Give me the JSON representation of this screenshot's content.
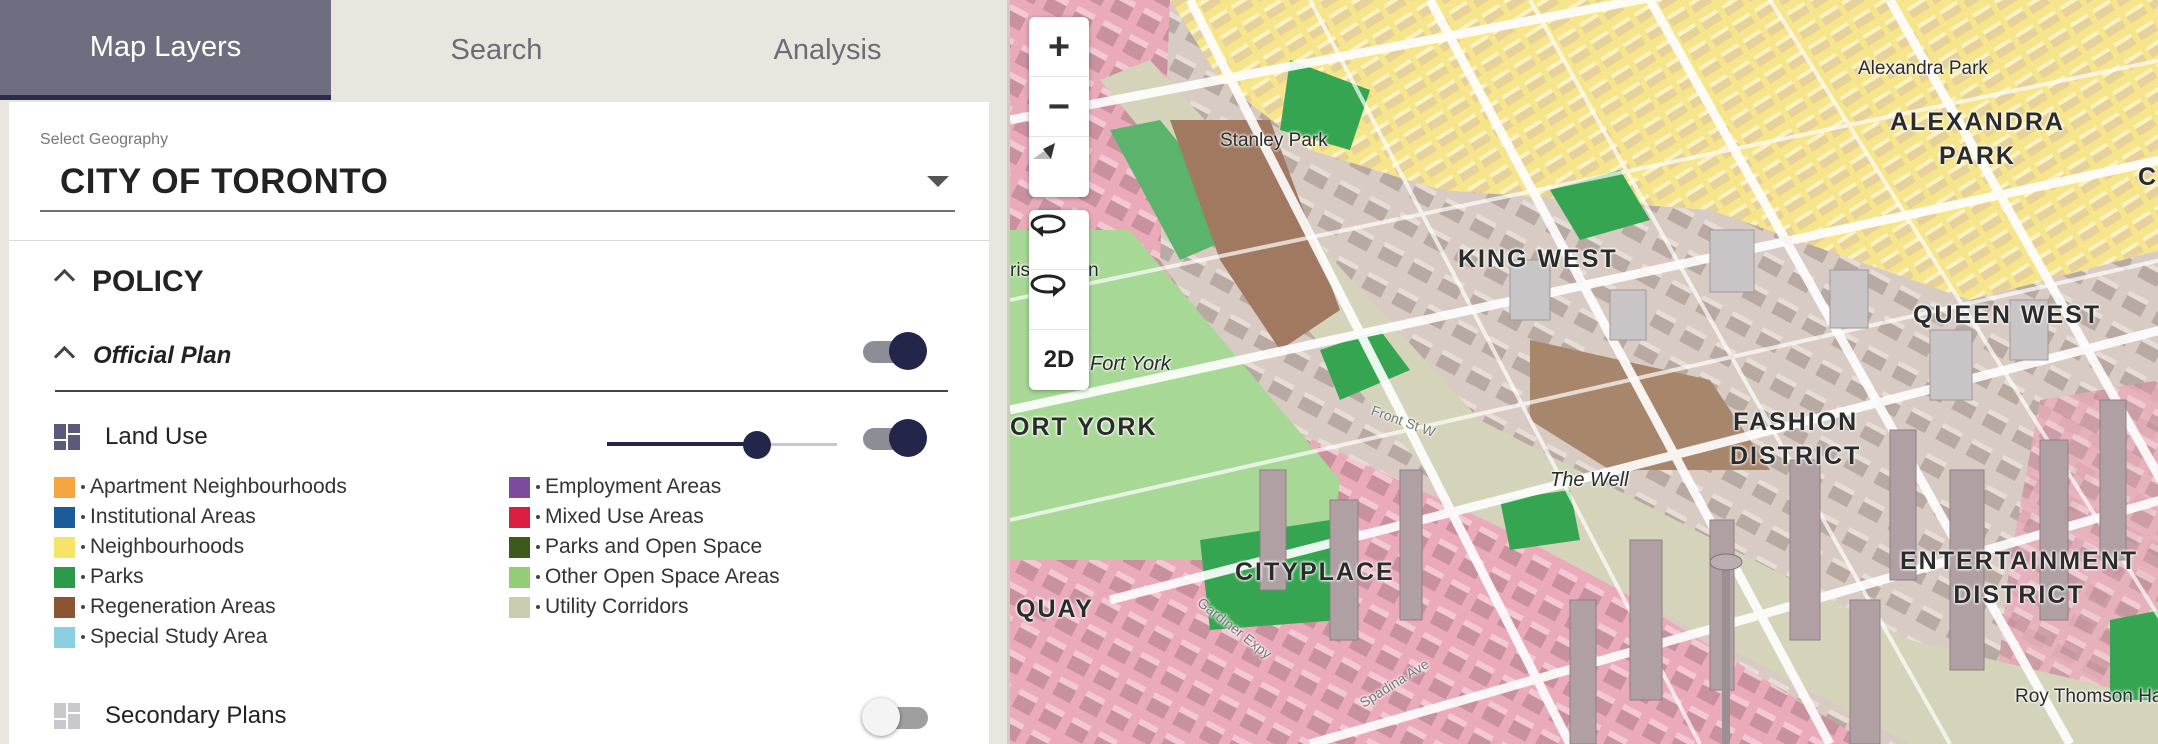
{
  "tabs": [
    {
      "label": "Map Layers",
      "active": true
    },
    {
      "label": "Search",
      "active": false
    },
    {
      "label": "Analysis",
      "active": false
    }
  ],
  "geography": {
    "label": "Select Geography",
    "value": "CITY OF TORONTO"
  },
  "policy": {
    "title": "POLICY",
    "official_plan": {
      "title": "Official Plan",
      "enabled": true
    },
    "land_use": {
      "label": "Land Use",
      "enabled": true,
      "opacity": 0.65
    },
    "legend": [
      {
        "label": "Apartment Neighbourhoods",
        "color": "#f5a640"
      },
      {
        "label": "Institutional Areas",
        "color": "#1d5a9a"
      },
      {
        "label": "Neighbourhoods",
        "color": "#f7e367"
      },
      {
        "label": "Parks",
        "color": "#2c9a48"
      },
      {
        "label": "Regeneration Areas",
        "color": "#8c5334"
      },
      {
        "label": "Special Study Area",
        "color": "#8bd0e2"
      },
      {
        "label": "Employment Areas",
        "color": "#7d4a9c"
      },
      {
        "label": "Mixed Use Areas",
        "color": "#d91e41"
      },
      {
        "label": "Parks and Open Space",
        "color": "#3c5a1c"
      },
      {
        "label": "Other Open Space Areas",
        "color": "#93cd77"
      },
      {
        "label": "Utility Corridors",
        "color": "#c9cdae"
      }
    ],
    "secondary_plans": {
      "label": "Secondary Plans",
      "enabled": false
    }
  },
  "map": {
    "controls": {
      "zoom_in": "+",
      "zoom_out": "−",
      "mode_2d": "2D"
    },
    "labels": {
      "alexandra_park_small": "Alexandra Park",
      "alexandra_park_district": "ALEXANDRA\nPARK",
      "stanley_park": "Stanley Park",
      "king_west": "KING WEST",
      "queen_west": "QUEEN WEST",
      "fashion_district": "FASHION\nDISTRICT",
      "fort_york_park": "Fort York",
      "fort_york": "ORT YORK",
      "the_well": "The Well",
      "cityplace": "CITYPLACE",
      "entertainment_district": "ENTERTAINMENT\nDISTRICT",
      "quay": "QUAY",
      "roy_thomson": "Roy Thomson Ha",
      "common": "ris    nmon",
      "edge_c": "C",
      "front_st": "Front St W",
      "gardiner": "Gardiner Expy",
      "spadina": "Spadina Ave"
    }
  }
}
